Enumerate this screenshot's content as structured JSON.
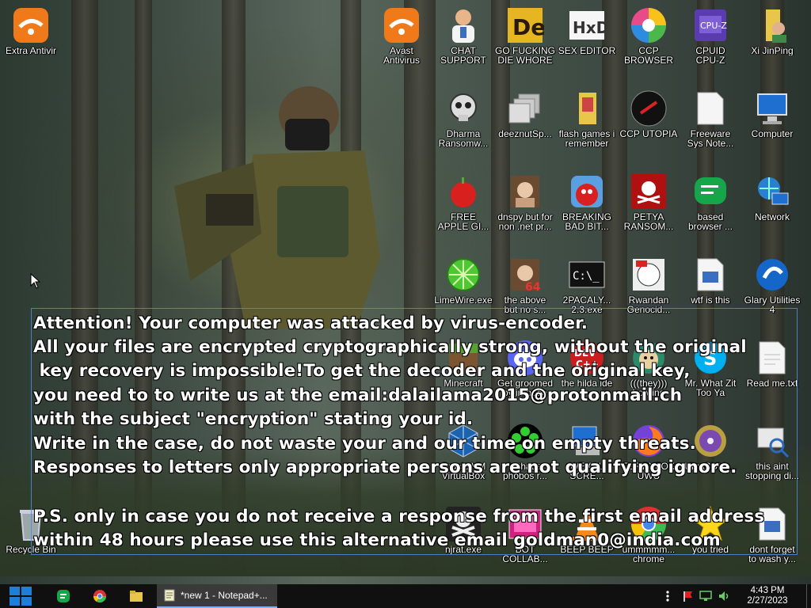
{
  "desktop": {
    "icons": [
      {
        "key": "extra-antivir",
        "label": "Extra Antivir"
      },
      {
        "key": "avast",
        "label": "Avast\nAntivirus"
      },
      {
        "key": "chat-support",
        "label": "CHAT\nSUPPORT"
      },
      {
        "key": "go-die",
        "label": "GO FUCKING\nDIE WHORE"
      },
      {
        "key": "sex-editor",
        "label": "SEX EDITOR"
      },
      {
        "key": "ccp-browser",
        "label": "CCP\nBROWSER"
      },
      {
        "key": "cpuid",
        "label": "CPUID\nCPU-Z"
      },
      {
        "key": "xi-jinping",
        "label": "Xi JinPing"
      },
      {
        "key": "dharma",
        "label": "Dharma\nRansomw..."
      },
      {
        "key": "deeznut",
        "label": "deeznutSp..."
      },
      {
        "key": "flash-games",
        "label": "flash games i\nremember"
      },
      {
        "key": "ccp-utopia",
        "label": "CCP UTOPIA"
      },
      {
        "key": "freeware",
        "label": "Freeware\nSys Note..."
      },
      {
        "key": "computer",
        "label": "Computer"
      },
      {
        "key": "free-apple",
        "label": "FREE\nAPPLE GI..."
      },
      {
        "key": "dnspy",
        "label": "dnspy but for\nnon .net pr..."
      },
      {
        "key": "breaking-bad",
        "label": "BREAKING\nBAD BIT..."
      },
      {
        "key": "petya",
        "label": "PETYA\nRANSOM..."
      },
      {
        "key": "based-browser",
        "label": "based\nbrowser ..."
      },
      {
        "key": "network",
        "label": "Network"
      },
      {
        "key": "limewire",
        "label": "LimeWire.exe"
      },
      {
        "key": "above",
        "label": "the above\nbut no s..."
      },
      {
        "key": "2pacaly",
        "label": "2PACALY...\n2.3.exe"
      },
      {
        "key": "rwandan",
        "label": "Rwandan\nGenocid..."
      },
      {
        "key": "wtf",
        "label": "wtf is this"
      },
      {
        "key": "glary",
        "label": "Glary Utilities\n4"
      },
      {
        "key": "minecraft",
        "label": "Minecraft"
      },
      {
        "key": "groomed",
        "label": "Get groomed\nby inrouge"
      },
      {
        "key": "hilda",
        "label": "the hilda ide"
      },
      {
        "key": "bowling",
        "label": "(((they)))\nbowling"
      },
      {
        "key": "mr-what",
        "label": "Mr. What Zit\nToo Ya"
      },
      {
        "key": "readme",
        "label": "Read me.txt"
      },
      {
        "key": "oracle-vm",
        "label": "Oracle VM\nVirtualBox"
      },
      {
        "key": "phobos",
        "label": "is that a\nphobos r..."
      },
      {
        "key": "we-all",
        "label": "WE ALL\nSCRE..."
      },
      {
        "key": "furryfox",
        "label": "FURRYFOX\nUWU"
      },
      {
        "key": "ultrabull",
        "label": "UltraBULL..."
      },
      {
        "key": "this-aint",
        "label": "this aint\nstopping di..."
      },
      {
        "key": "recycle",
        "label": "Recycle Bin"
      },
      {
        "key": "njrat",
        "label": "njrat.exe"
      },
      {
        "key": "bot-collab",
        "label": "BOT\nCOLLAB..."
      },
      {
        "key": "beep",
        "label": "BEEP BEEP"
      },
      {
        "key": "chrome",
        "label": "ummmmm...\nchrome"
      },
      {
        "key": "you-tried",
        "label": "you tried"
      },
      {
        "key": "wash",
        "label": "dont forget\nto wash y..."
      }
    ]
  },
  "ransom_note": {
    "lines": [
      "Attention! Your computer was attacked by virus-encoder.",
      "All your files are encrypted cryptographically strong, without the original",
      " key recovery is impossible!To get the decoder and the original key,",
      "you need to to write us at the email:dalailama2015@protonmail.ch",
      "with the subject \"encryption\" stating your id.",
      "Write in the case, do not waste your and our time on empty threats.",
      "Responses to letters only appropriate persons are not qualifying ignore.",
      "",
      "P.S. only in case you do not receive a response from the first email address",
      "within 48 hours please use this alternative email goldman0@india.com"
    ]
  },
  "taskbar": {
    "active_window": "*new 1 - Notepad+...",
    "time": "4:43 PM",
    "date": "2/27/2023",
    "colors": {
      "start": "#1e7fd8",
      "notepad_active": "#3a3a3a"
    }
  }
}
